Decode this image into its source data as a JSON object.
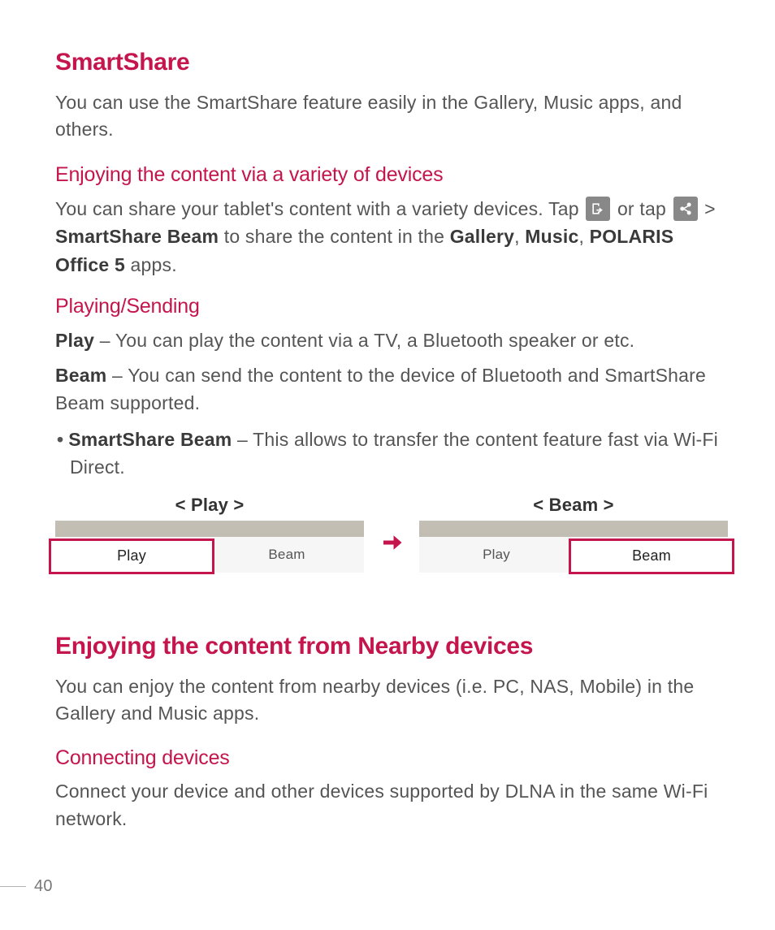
{
  "h_smartshare": "SmartShare",
  "p_smartshare_intro": "You can use the SmartShare feature easily in the Gallery, Music apps, and others.",
  "h_enjoy_variety": "Enjoying the content via a variety of devices",
  "txt_share_pre": "You can share your tablet's content with a variety devices. Tap ",
  "txt_share_mid": " or tap ",
  "txt_share_post_1": " > ",
  "bold_smartshare_beam": "SmartShare Beam",
  "txt_share_post_2": " to share the content in the ",
  "bold_gallery": "Gallery",
  "comma1": ", ",
  "bold_music": "Music",
  "comma2": ", ",
  "bold_polaris": "POLARIS Office 5",
  "txt_apps_end": " apps.",
  "h_playing_sending": "Playing/Sending",
  "bold_play": "Play",
  "txt_play_def": " – You can play the content via a TV, a Bluetooth speaker or etc.",
  "bold_beam": "Beam",
  "txt_beam_def": " – You can send the content to the device of Bluetooth and SmartShare Beam supported.",
  "bullet_dot": "•",
  "bold_ss_beam": "SmartShare Beam",
  "txt_ss_beam_def": " – This allows to transfer the content feature fast via Wi-Fi Direct.",
  "caption_play": "< Play >",
  "caption_beam": "< Beam >",
  "tab_play": "Play",
  "tab_beam": "Beam",
  "h_enjoy_nearby": "Enjoying the content from Nearby devices",
  "p_enjoy_nearby": "You can enjoy the content from nearby devices (i.e. PC, NAS, Mobile) in the Gallery and Music apps.",
  "h_connecting": "Connecting devices",
  "p_connecting": "Connect your device and other devices supported by DLNA in the same Wi-Fi network.",
  "page_number": "40"
}
